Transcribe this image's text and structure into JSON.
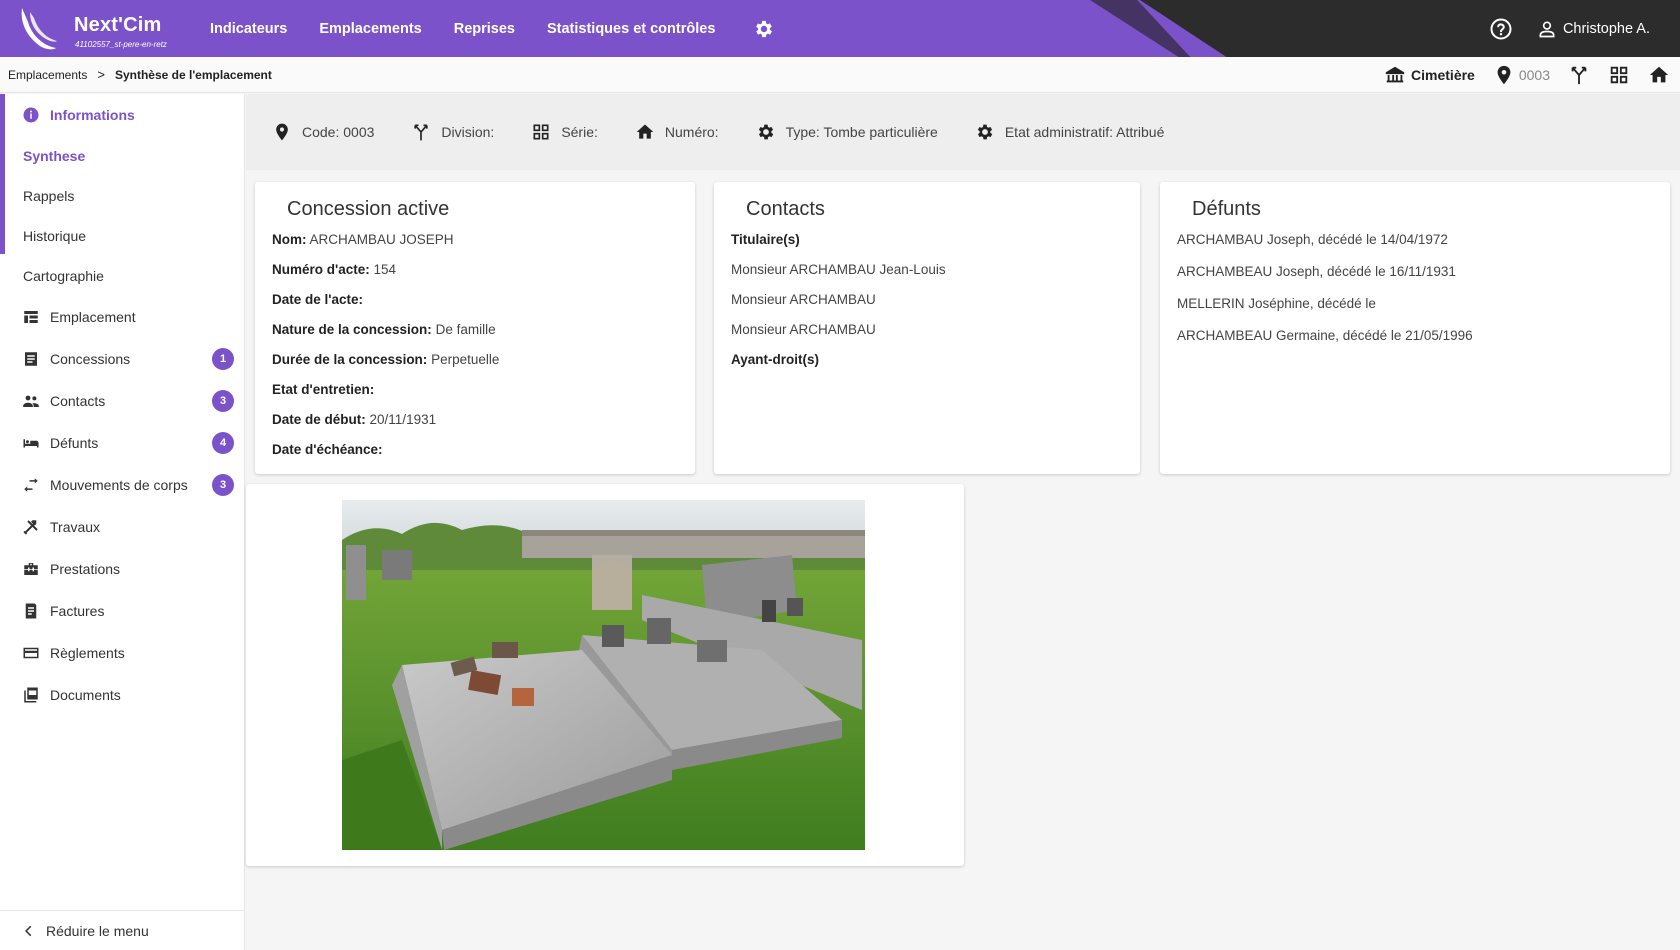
{
  "header": {
    "brand": "Next'Cim",
    "brand_sub": "41102557_st-pere-en-retz",
    "nav": [
      "Indicateurs",
      "Emplacements",
      "Reprises",
      "Statistiques et contrôles"
    ],
    "user": "Christophe A."
  },
  "breadcrumb": {
    "items": [
      "Emplacements",
      "Synthèse de l'emplacement"
    ],
    "separator": ">",
    "cimetiere": "Cimetière",
    "code": "0003"
  },
  "sidebar": {
    "header": "Informations",
    "subitems": [
      "Synthese",
      "Rappels",
      "Historique",
      "Cartographie"
    ],
    "items": [
      {
        "label": "Emplacement",
        "badge": ""
      },
      {
        "label": "Concessions",
        "badge": "1"
      },
      {
        "label": "Contacts",
        "badge": "3"
      },
      {
        "label": "Défunts",
        "badge": "4"
      },
      {
        "label": "Mouvements de corps",
        "badge": "3"
      },
      {
        "label": "Travaux",
        "badge": ""
      },
      {
        "label": "Prestations",
        "badge": ""
      },
      {
        "label": "Factures",
        "badge": ""
      },
      {
        "label": "Règlements",
        "badge": ""
      },
      {
        "label": "Documents",
        "badge": ""
      }
    ],
    "collapse": "Réduire le menu"
  },
  "info": {
    "code": "Code: 0003",
    "division": "Division:",
    "serie": "Série:",
    "numero": "Numéro:",
    "type": "Type: Tombe particulière",
    "etat": "Etat administratif: Attribué"
  },
  "concession": {
    "title": "Concession active",
    "rows": [
      {
        "label": "Nom:",
        "value": "ARCHAMBAU JOSEPH"
      },
      {
        "label": "Numéro d'acte:",
        "value": "154"
      },
      {
        "label": "Date de l'acte:",
        "value": ""
      },
      {
        "label": "Nature de la concession:",
        "value": "De famille"
      },
      {
        "label": "Durée de la concession:",
        "value": "Perpetuelle"
      },
      {
        "label": "Etat d'entretien:",
        "value": ""
      },
      {
        "label": "Date de début:",
        "value": "20/11/1931"
      },
      {
        "label": "Date d'échéance:",
        "value": ""
      }
    ]
  },
  "contacts": {
    "title": "Contacts",
    "titulaires_label": "Titulaire(s)",
    "titulaires": [
      "Monsieur ARCHAMBAU Jean-Louis",
      "Monsieur ARCHAMBAU",
      "Monsieur ARCHAMBAU"
    ],
    "ayants_label": "Ayant-droit(s)"
  },
  "defunts": {
    "title": "Défunts",
    "list": [
      "ARCHAMBAU Joseph, décédé le 14/04/1972",
      "ARCHAMBEAU Joseph, décédé le 16/11/1931",
      "MELLERIN Joséphine, décédé le",
      "ARCHAMBEAU Germaine, décédé le 21/05/1996"
    ]
  },
  "colors": {
    "accent": "#7b52c9",
    "dark": "#2c2c2c"
  }
}
